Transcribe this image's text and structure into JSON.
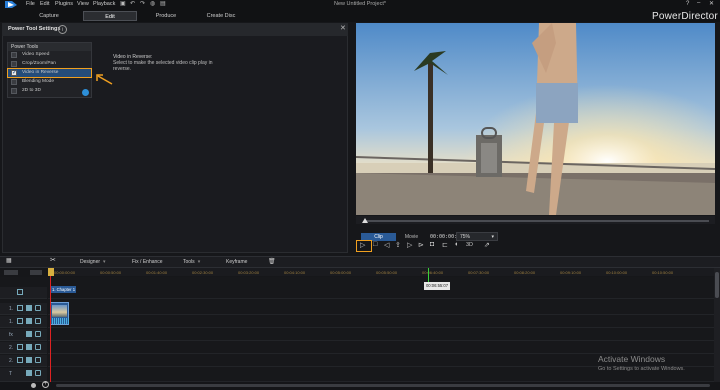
{
  "titlebar": {
    "menus": [
      "File",
      "Edit",
      "Plugins",
      "View",
      "Playback"
    ],
    "document_title": "New Untitled Project*",
    "help": "?"
  },
  "modes": [
    {
      "label": "Capture"
    },
    {
      "label": "Edit"
    },
    {
      "label": "Produce"
    },
    {
      "label": "Create Disc"
    }
  ],
  "brand": "PowerDirector",
  "panel": {
    "title": "Power Tool Settings",
    "info_icon": "i",
    "group_title": "Power Tools",
    "tools": [
      {
        "label": "Video Speed",
        "checked": false
      },
      {
        "label": "Crop/Zoom/Pan",
        "checked": false
      },
      {
        "label": "Video in Reverse",
        "checked": true
      },
      {
        "label": "Blending Mode",
        "checked": false
      },
      {
        "label": "2D to 3D",
        "checked": false
      }
    ],
    "description_title": "Video in Reverse:",
    "description": "Select to make the selected video clip play in reverse."
  },
  "preview": {
    "clip_tab": "Clip",
    "movie_tab": "Movie",
    "timecode": "00:00:00:00",
    "zoom": "75%",
    "mode_3d": "3D"
  },
  "toolbar": {
    "designer": "Designer",
    "fix_enhance": "Fix / Enhance",
    "tools": "Tools",
    "keyframe": "Keyframe"
  },
  "timeline": {
    "ticks": [
      "00:00:00:00",
      "00:00:50:00",
      "00:01:40:00",
      "00:02:30:00",
      "00:03:20:00",
      "00:04:10:00",
      "00:05:00:00",
      "00:05:50:00",
      "00:06:40:00",
      "00:07:30:00",
      "00:08:20:00",
      "00:09:10:00",
      "00:10:00:00",
      "00:10:50:00"
    ],
    "tooltip": "00:06:55:07",
    "chapter": "1. Chapter 1",
    "tracks": [
      {
        "label": "1."
      },
      {
        "label": "1."
      },
      {
        "label": "fx"
      },
      {
        "label": "2."
      },
      {
        "label": "2."
      },
      {
        "label": "T"
      },
      {
        "label": ""
      }
    ]
  },
  "watermark": {
    "title": "Activate Windows",
    "subtitle": "Go to Settings to activate Windows."
  },
  "colors": {
    "accent_orange": "#f0a020",
    "selection_blue": "#244c7a",
    "playhead_red": "#dd2222"
  }
}
